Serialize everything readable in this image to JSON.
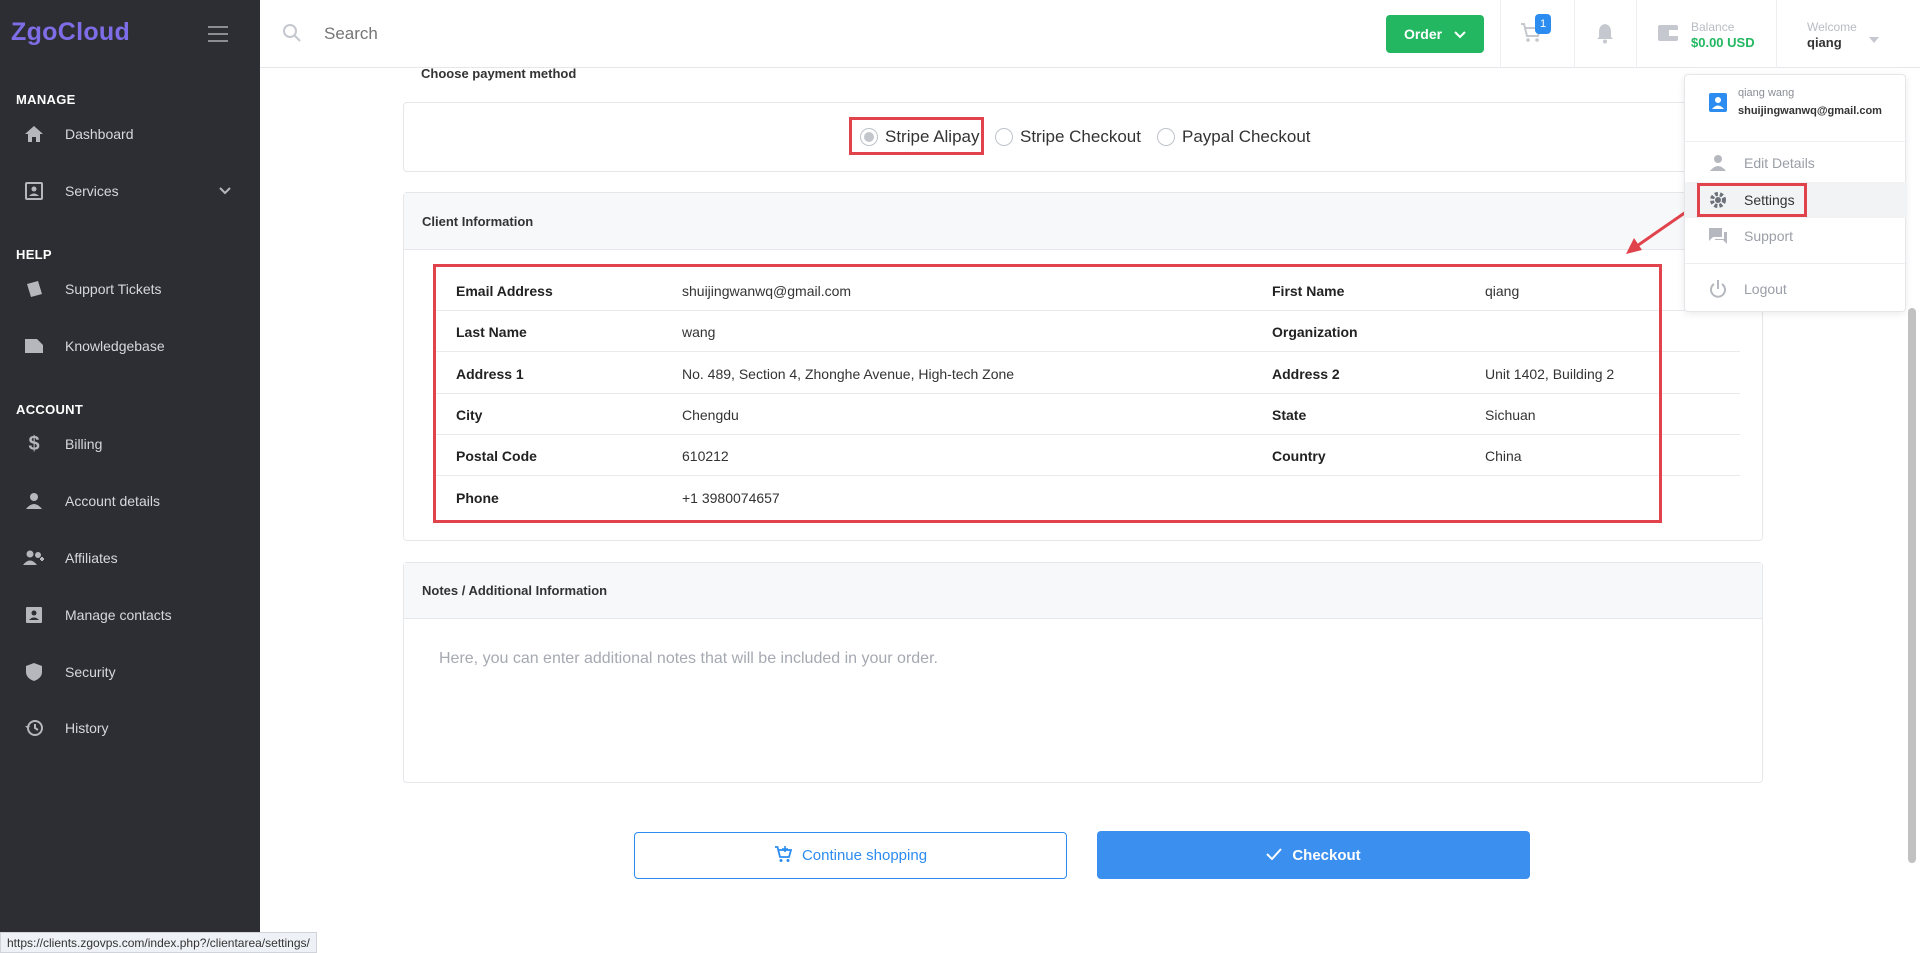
{
  "brand": "ZgoCloud",
  "sidebar": {
    "sections": [
      {
        "title": "MANAGE"
      },
      {
        "title": "HELP"
      },
      {
        "title": "ACCOUNT"
      }
    ],
    "items": [
      {
        "label": "Dashboard",
        "icon": "home-icon"
      },
      {
        "label": "Services",
        "icon": "services-icon"
      },
      {
        "label": "Support Tickets",
        "icon": "ticket-icon"
      },
      {
        "label": "Knowledgebase",
        "icon": "book-icon"
      },
      {
        "label": "Billing",
        "icon": "dollar-icon"
      },
      {
        "label": "Account details",
        "icon": "user-icon"
      },
      {
        "label": "Affiliates",
        "icon": "affiliates-icon"
      },
      {
        "label": "Manage contacts",
        "icon": "contacts-icon"
      },
      {
        "label": "Security",
        "icon": "shield-icon"
      },
      {
        "label": "History",
        "icon": "history-icon"
      }
    ]
  },
  "topbar": {
    "search_placeholder": "Search",
    "order_label": "Order",
    "cart_count": "1",
    "balance_label": "Balance",
    "balance_value": "$0.00 USD",
    "welcome_label": "Welcome",
    "welcome_name": "qiang"
  },
  "payment": {
    "title": "Choose payment method",
    "options": [
      "Stripe Alipay",
      "Stripe Checkout",
      "Paypal Checkout"
    ],
    "selected": "Stripe Alipay"
  },
  "client_info": {
    "title": "Client Information",
    "rows": [
      {
        "k1": "Email Address",
        "v1": "shuijingwanwq@gmail.com",
        "k2": "First Name",
        "v2": "qiang"
      },
      {
        "k1": "Last Name",
        "v1": "wang",
        "k2": "Organization",
        "v2": ""
      },
      {
        "k1": "Address 1",
        "v1": "No. 489, Section 4, Zhonghe Avenue, High-tech Zone",
        "k2": "Address 2",
        "v2": "Unit 1402, Building 2"
      },
      {
        "k1": "City",
        "v1": "Chengdu",
        "k2": "State",
        "v2": "Sichuan"
      },
      {
        "k1": "Postal Code",
        "v1": "610212",
        "k2": "Country",
        "v2": "China"
      },
      {
        "k1": "Phone",
        "v1": "+1 3980074657",
        "k2": "",
        "v2": ""
      }
    ]
  },
  "notes": {
    "title": "Notes / Additional Information",
    "placeholder": "Here, you can enter additional notes that will be included in your order."
  },
  "actions": {
    "continue_label": "Continue shopping",
    "checkout_label": "Checkout"
  },
  "dropdown": {
    "name": "qiang wang",
    "email": "shuijingwanwq@gmail.com",
    "items": [
      "Edit Details",
      "Settings",
      "Support",
      "Logout"
    ]
  },
  "status_url": "https://clients.zgovps.com/index.php?/clientarea/settings/",
  "colors": {
    "sidebar_bg": "#2d2e33",
    "brand": "#7d6ee7",
    "accent_blue": "#3b8fee",
    "order_green": "#22b760",
    "highlight_red": "#e0434b"
  }
}
